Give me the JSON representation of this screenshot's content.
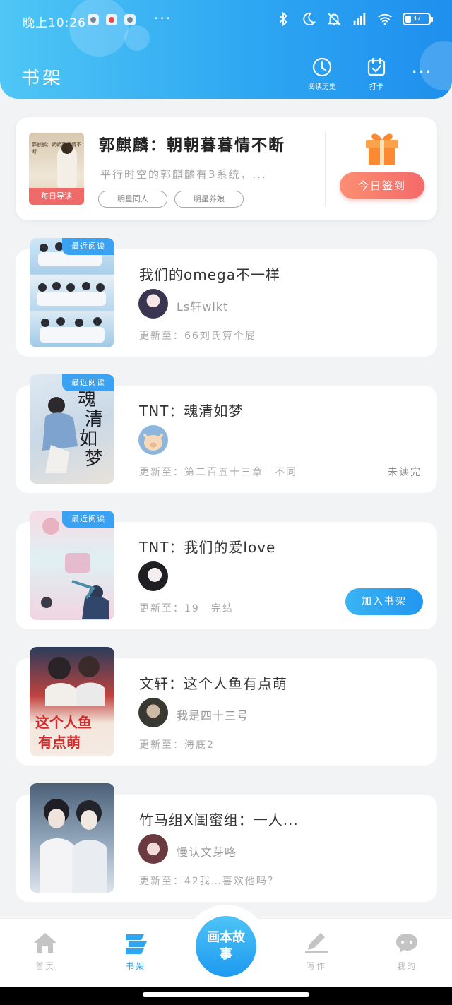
{
  "status_bar": {
    "time": "晚上10:26",
    "more": "···",
    "battery": "37"
  },
  "header": {
    "title": "书架",
    "history_label": "阅读历史",
    "checkin_label": "打卡",
    "more_label": "···"
  },
  "signin_card": {
    "cover_text": "郭麒麟：朝朝暮暮情不断",
    "badge": "每日导读",
    "title": "郭麒麟：朝朝暮暮情不断",
    "description": "平行时空的郭麒麟有3系统，...",
    "tags": [
      "明星同人",
      "明星养娘"
    ],
    "button": "今日签到"
  },
  "books": [
    {
      "badge": "最近阅读",
      "title": "我们的omega不一样",
      "author": "Ls轩wlkt",
      "update": "更新至：66刘氏算个屁",
      "status": ""
    },
    {
      "badge": "最近阅读",
      "title": "TNT：魂清如梦",
      "author": "",
      "update": "更新至：第二百五十三章　不同",
      "status": "未读完"
    },
    {
      "badge": "最近阅读",
      "title": "TNT：我们的爱love",
      "author": "",
      "update": "更新至：19　完结",
      "status": "",
      "add_button": "加入书架"
    },
    {
      "badge": "",
      "title": "文轩：这个人鱼有点萌",
      "author": "我是四十三号",
      "update": "更新至：海底2",
      "status": ""
    },
    {
      "badge": "",
      "title": "竹马组X闺蜜组：一人...",
      "author": "慢认文芽咯",
      "update": "更新至：42我…喜欢他吗？",
      "status": ""
    }
  ],
  "bottom_nav": {
    "home": "首页",
    "shelf": "书架",
    "center": "画本故事",
    "write": "写作",
    "mine": "我的"
  },
  "colors": {
    "primary": "#2ea7f2",
    "signin": "#f46a6a",
    "background": "#f2f3f5"
  }
}
